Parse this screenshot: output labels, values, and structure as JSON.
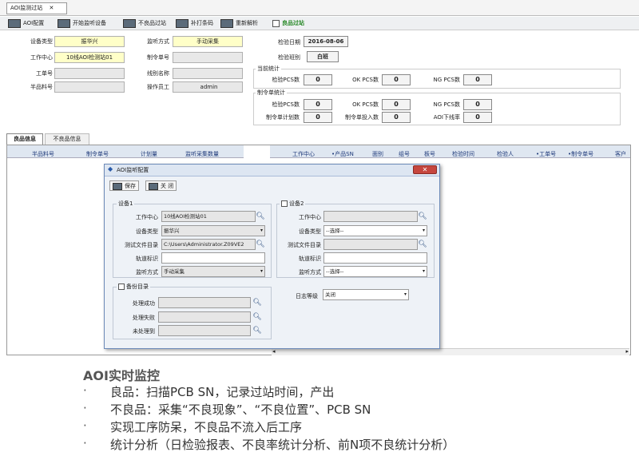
{
  "window_tab": {
    "title": "AOI监测过站",
    "close": "✕"
  },
  "toolbar": {
    "buttons": [
      "AOI配置",
      "开始监听设备",
      "不良品过站",
      "补打条码",
      "重新解析"
    ],
    "checkbox_label": "良品过站"
  },
  "form": {
    "device_type": {
      "label": "设备类型",
      "value": "振华兴"
    },
    "work_center": {
      "label": "工作中心",
      "value": "10线AOI检测站01"
    },
    "work_order": {
      "label": "工单号",
      "value": ""
    },
    "semi_part": {
      "label": "半品料号",
      "value": ""
    },
    "monitor_mode": {
      "label": "监听方式",
      "value": "手动采集"
    },
    "order_no": {
      "label": "制令单号",
      "value": ""
    },
    "line_name": {
      "label": "线别名称",
      "value": ""
    },
    "operator": {
      "label": "操作员工",
      "value": "admin"
    },
    "inspect_date": {
      "label": "检验日期",
      "value": "2016-08-06"
    },
    "inspect_shift": {
      "label": "检验班别",
      "value": "白班"
    }
  },
  "current_stats": {
    "title": "当前统计",
    "items": [
      {
        "label": "检验PCS数",
        "value": "0"
      },
      {
        "label": "OK PCS数",
        "value": "0"
      },
      {
        "label": "NG PCS数",
        "value": "0"
      }
    ]
  },
  "order_stats": {
    "title": "制令单统计",
    "row1": [
      {
        "label": "检验PCS数",
        "value": "0"
      },
      {
        "label": "OK PCS数",
        "value": "0"
      },
      {
        "label": "NG PCS数",
        "value": "0"
      }
    ],
    "row2": [
      {
        "label": "制令单计划数",
        "value": "0"
      },
      {
        "label": "制令单投入数",
        "value": "0"
      },
      {
        "label": "AOI下线率",
        "value": "0"
      }
    ]
  },
  "tabs": [
    "良品信息",
    "不良品信息"
  ],
  "left_table": {
    "columns": [
      "半品料号",
      "制令单号",
      "计划量",
      "监听采集数量"
    ]
  },
  "right_table": {
    "columns": [
      "工作中心",
      "•产品SN",
      "面别",
      "组号",
      "板号",
      "检验时间",
      "检验人",
      "•工单号",
      "•制令单号",
      "客户"
    ]
  },
  "dialog": {
    "title": "AOI监听配置",
    "save": "保存",
    "close": "关 闭",
    "device1": {
      "title": "设备1",
      "work_center": {
        "label": "工作中心",
        "value": "10线AOI检测站01"
      },
      "device_type": {
        "label": "设备类型",
        "value": "振华兴"
      },
      "test_dir": {
        "label": "测试文件目录",
        "value": "C:\\Users\\Administrator.Z09VE2"
      },
      "track_id": {
        "label": "轨道标识",
        "value": ""
      },
      "monitor_mode": {
        "label": "监听方式",
        "value": "手动采集"
      }
    },
    "device2": {
      "title": "设备2",
      "work_center": {
        "label": "工作中心",
        "value": ""
      },
      "device_type": {
        "label": "设备类型",
        "value": "--选择--"
      },
      "test_dir": {
        "label": "测试文件目录",
        "value": ""
      },
      "track_id": {
        "label": "轨道标识",
        "value": ""
      },
      "monitor_mode": {
        "label": "监听方式",
        "value": "--选择--"
      }
    },
    "backup": {
      "title": "备份目录",
      "success": {
        "label": "处理成功",
        "value": ""
      },
      "fail": {
        "label": "处理失败",
        "value": ""
      },
      "unprocessed": {
        "label": "未处理到",
        "value": ""
      }
    },
    "log_level": {
      "label": "日志等级",
      "value": "关闭"
    }
  },
  "caption": {
    "title": "AOI实时监控",
    "bullets": [
      "良品：扫描PCB SN，记录过站时间，产出",
      "不良品：采集“不良现象”、“不良位置”、PCB SN",
      "实现工序防呆，不良品不流入后工序",
      "统计分析（日检验报表、不良率统计分析、前N项不良统计分析）"
    ]
  }
}
